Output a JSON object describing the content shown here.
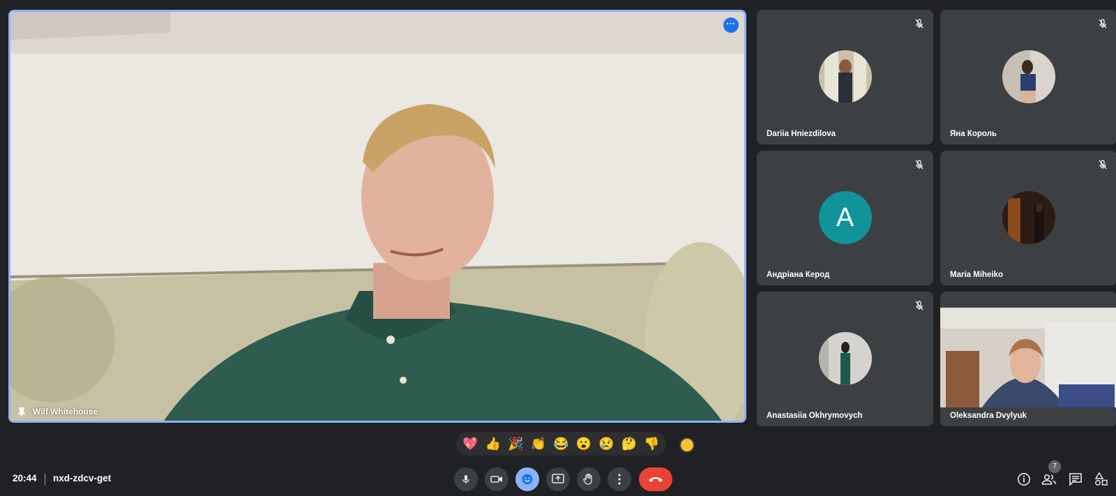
{
  "meeting": {
    "time": "20:44",
    "code": "nxd-zdcv-get"
  },
  "main_speaker": {
    "name": "Wilf Whitehouse",
    "pinned": true,
    "menu_icon": "more-horiz-icon"
  },
  "participants": [
    {
      "name": "Dariia Hniezdilova",
      "muted": true,
      "avatar": "photo"
    },
    {
      "name": "Яна Король",
      "muted": true,
      "avatar": "photo"
    },
    {
      "name": "Андріана Керод",
      "muted": true,
      "avatar": "letter",
      "letter": "A",
      "color": "#12939a"
    },
    {
      "name": "Maria Miheiko",
      "muted": true,
      "avatar": "photo"
    },
    {
      "name": "Anastasiia Okhrymovych",
      "muted": true,
      "avatar": "photo"
    },
    {
      "name": "Oleksandra Dvylyuk",
      "muted": false,
      "avatar": "video"
    }
  ],
  "reactions": [
    "💖",
    "👍",
    "🎉",
    "👏",
    "😂",
    "😮",
    "😢",
    "🤔",
    "👎"
  ],
  "controls": [
    {
      "name": "microphone",
      "icon": "mic-icon"
    },
    {
      "name": "camera",
      "icon": "videocam-icon"
    },
    {
      "name": "reactions",
      "icon": "emoji-icon",
      "active": true
    },
    {
      "name": "present",
      "icon": "present-screen-icon"
    },
    {
      "name": "raise-hand",
      "icon": "hand-icon"
    },
    {
      "name": "more",
      "icon": "more-vert-icon"
    },
    {
      "name": "leave-call",
      "icon": "call-end-icon"
    }
  ],
  "right_panel": {
    "people_count": "7",
    "icons": [
      "info-icon",
      "people-icon",
      "chat-icon",
      "activities-icon"
    ]
  },
  "colors": {
    "background": "#202124",
    "tile": "#3c4043",
    "active_border": "#8ab4f8",
    "end_call": "#ea4335"
  }
}
